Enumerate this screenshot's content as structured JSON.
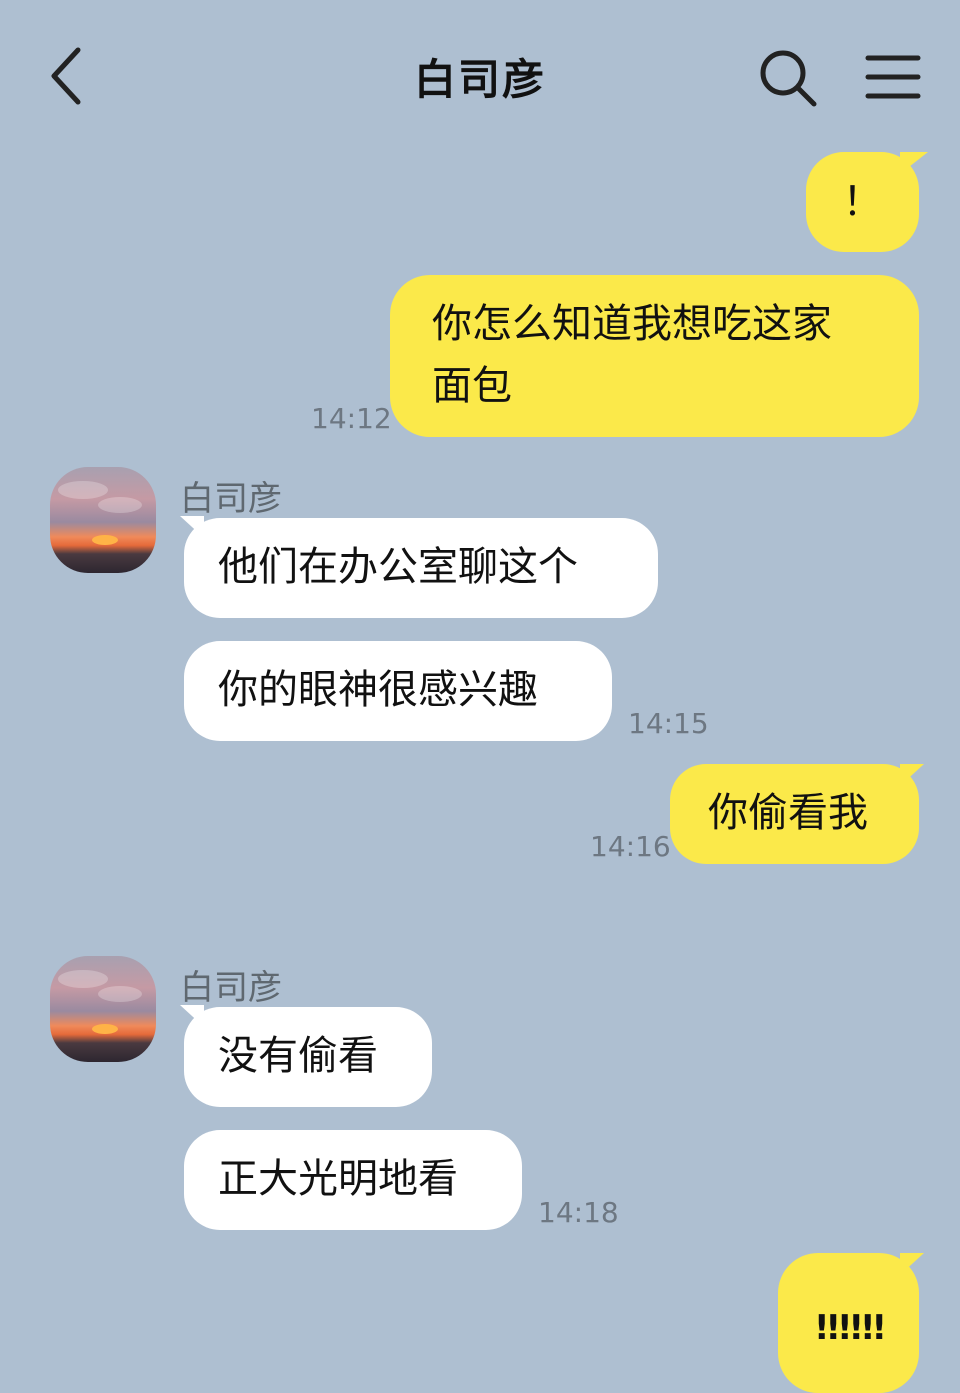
{
  "header": {
    "title": "白司彦"
  },
  "messages": {
    "m1": {
      "text": "！"
    },
    "m2": {
      "line1": "你怎么知道我想吃这家",
      "line2": "面包",
      "time": "14:12"
    },
    "g1": {
      "sender": "白司彦",
      "b1": "他们在办公室聊这个",
      "b2": "你的眼神很感兴趣",
      "time": "14:15"
    },
    "m3": {
      "text": "你偷看我",
      "time": "14:16"
    },
    "g2": {
      "sender": "白司彦",
      "b1": "没有偷看",
      "b2": "正大光明地看",
      "time": "14:18"
    },
    "m4": {
      "text": "!!!!!!"
    }
  },
  "colors": {
    "background": "#aebfd1",
    "my_bubble": "#fbe94a",
    "other_bubble": "#ffffff"
  },
  "icons": [
    "back-icon",
    "search-icon",
    "menu-icon"
  ]
}
